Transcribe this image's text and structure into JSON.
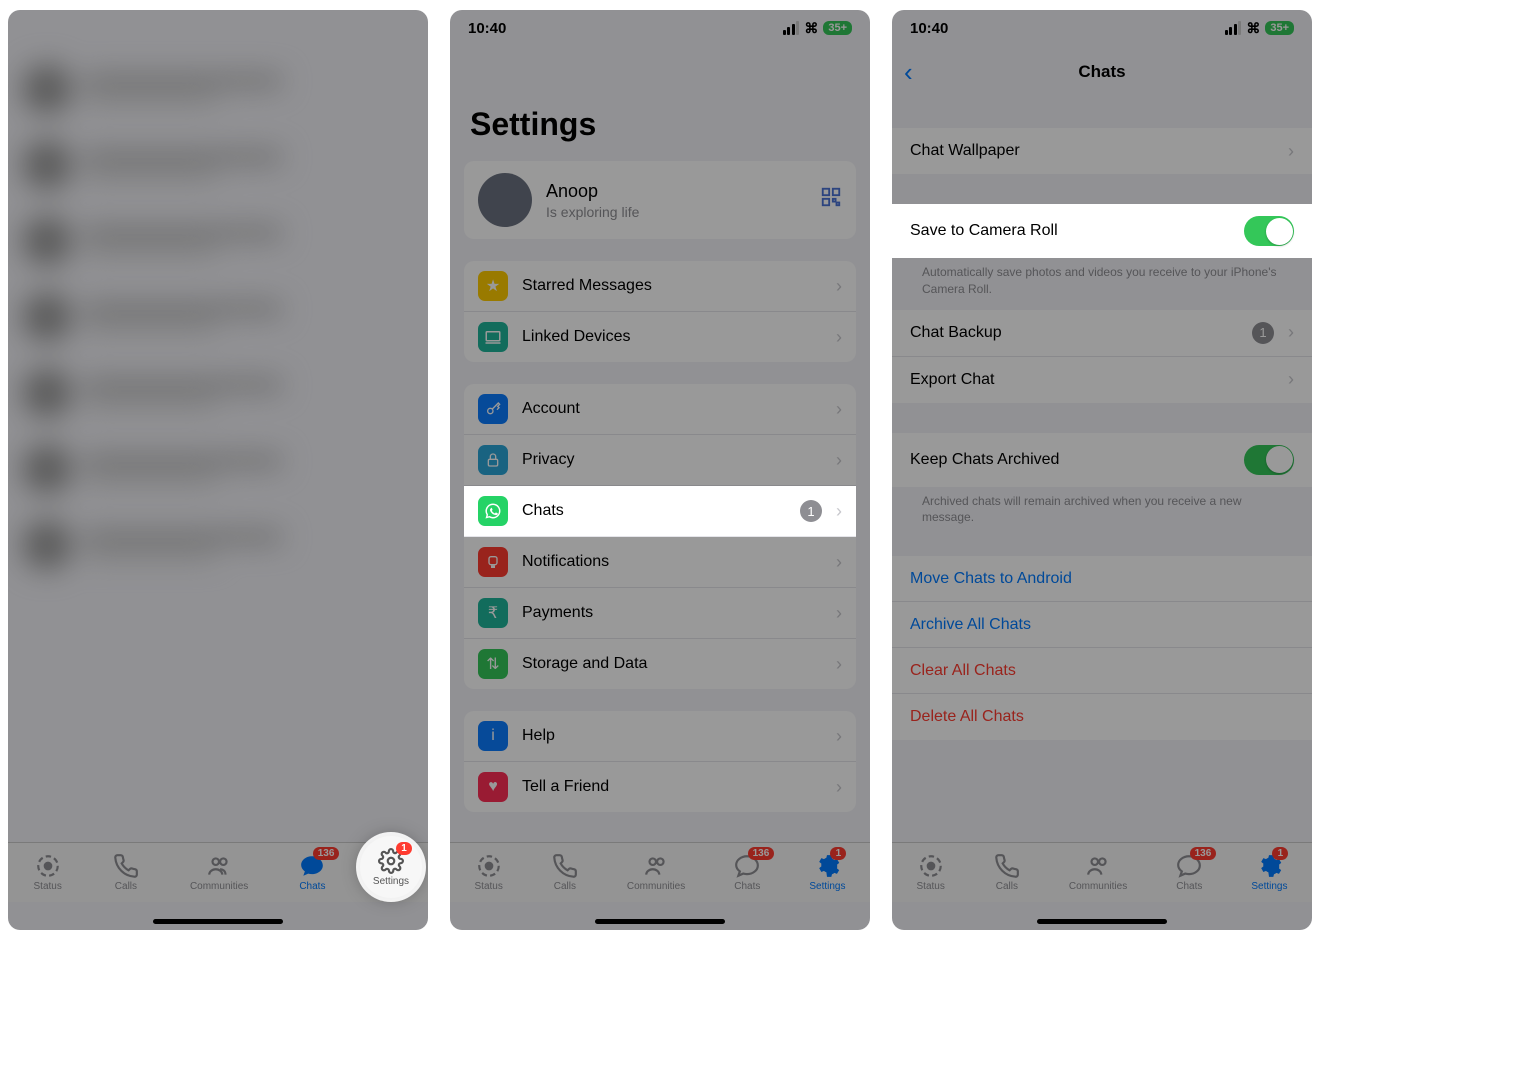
{
  "status": {
    "time": "10:40",
    "battery": "35+",
    "carrier_bars": 3
  },
  "tabs": {
    "status": "Status",
    "calls": "Calls",
    "communities": "Communities",
    "chats": "Chats",
    "settings": "Settings",
    "chats_badge": "136",
    "settings_badge": "1"
  },
  "screen2": {
    "title": "Settings",
    "profile": {
      "name": "Anoop",
      "status": "Is exploring life"
    },
    "group1": {
      "starred": "Starred Messages",
      "linked": "Linked Devices"
    },
    "group2": {
      "account": "Account",
      "privacy": "Privacy",
      "chats": "Chats",
      "chats_badge": "1",
      "notifications": "Notifications",
      "payments": "Payments",
      "storage": "Storage and Data"
    },
    "group3": {
      "help": "Help",
      "tell": "Tell a Friend"
    }
  },
  "screen3": {
    "title": "Chats",
    "wallpaper": "Chat Wallpaper",
    "save_camera": "Save to Camera Roll",
    "save_note": "Automatically save photos and videos you receive to your iPhone's Camera Roll.",
    "backup": "Chat Backup",
    "backup_badge": "1",
    "export": "Export Chat",
    "archived": "Keep Chats Archived",
    "archived_note": "Archived chats will remain archived when you receive a new message.",
    "move": "Move Chats to Android",
    "archive_all": "Archive All Chats",
    "clear": "Clear All Chats",
    "delete": "Delete All Chats"
  }
}
